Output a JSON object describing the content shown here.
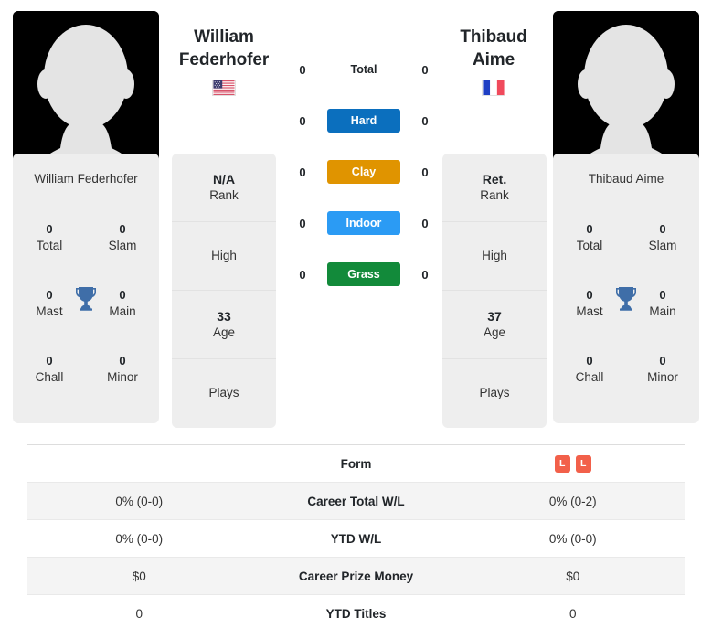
{
  "players": {
    "left": {
      "first_name": "William",
      "last_name": "Federhofer",
      "full_name": "William Federhofer",
      "flag": "us-flag-icon",
      "rank_value": "N/A",
      "rank_label": "Rank",
      "high_label": "High",
      "age_value": "33",
      "age_label": "Age",
      "plays_label": "Plays",
      "titles": [
        {
          "count": "0",
          "label": "Total"
        },
        {
          "count": "0",
          "label": "Slam"
        },
        {
          "count": "0",
          "label": "Mast"
        },
        {
          "count": "0",
          "label": "Main"
        },
        {
          "count": "0",
          "label": "Chall"
        },
        {
          "count": "0",
          "label": "Minor"
        }
      ]
    },
    "right": {
      "first_name": "Thibaud",
      "last_name": "Aime",
      "full_name": "Thibaud Aime",
      "flag": "fr-flag-icon",
      "rank_value": "Ret.",
      "rank_label": "Rank",
      "high_label": "High",
      "age_value": "37",
      "age_label": "Age",
      "plays_label": "Plays",
      "titles": [
        {
          "count": "0",
          "label": "Total"
        },
        {
          "count": "0",
          "label": "Slam"
        },
        {
          "count": "0",
          "label": "Mast"
        },
        {
          "count": "0",
          "label": "Main"
        },
        {
          "count": "0",
          "label": "Chall"
        },
        {
          "count": "0",
          "label": "Minor"
        }
      ]
    }
  },
  "surfaces": [
    {
      "label": "Total",
      "left": "0",
      "right": "0",
      "color": "transparent",
      "text_color": "#212529",
      "style": "plain"
    },
    {
      "label": "Hard",
      "left": "0",
      "right": "0",
      "color": "#0b6fbe",
      "text_color": "#ffffff",
      "style": "badge"
    },
    {
      "label": "Clay",
      "left": "0",
      "right": "0",
      "color": "#e09400",
      "text_color": "#ffffff",
      "style": "badge"
    },
    {
      "label": "Indoor",
      "left": "0",
      "right": "0",
      "color": "#2b9bf4",
      "text_color": "#ffffff",
      "style": "badge"
    },
    {
      "label": "Grass",
      "left": "0",
      "right": "0",
      "color": "#128a3a",
      "text_color": "#ffffff",
      "style": "badge"
    }
  ],
  "comparison_table": [
    {
      "label": "Form",
      "left": "",
      "right": "",
      "left_form": [],
      "right_form": [
        {
          "result": "L",
          "color": "#f2604a"
        },
        {
          "result": "L",
          "color": "#f2604a"
        }
      ]
    },
    {
      "label": "Career Total W/L",
      "left": "0% (0-0)",
      "right": "0% (0-2)"
    },
    {
      "label": "YTD W/L",
      "left": "0% (0-0)",
      "right": "0% (0-0)"
    },
    {
      "label": "Career Prize Money",
      "left": "$0",
      "right": "$0"
    },
    {
      "label": "YTD Titles",
      "left": "0",
      "right": "0"
    }
  ],
  "theme": {
    "card_bg": "#eeeeee",
    "photo_bg": "#000000",
    "trophy_color": "#3f6ea8",
    "row_alt_bg": "#f4f4f4"
  }
}
